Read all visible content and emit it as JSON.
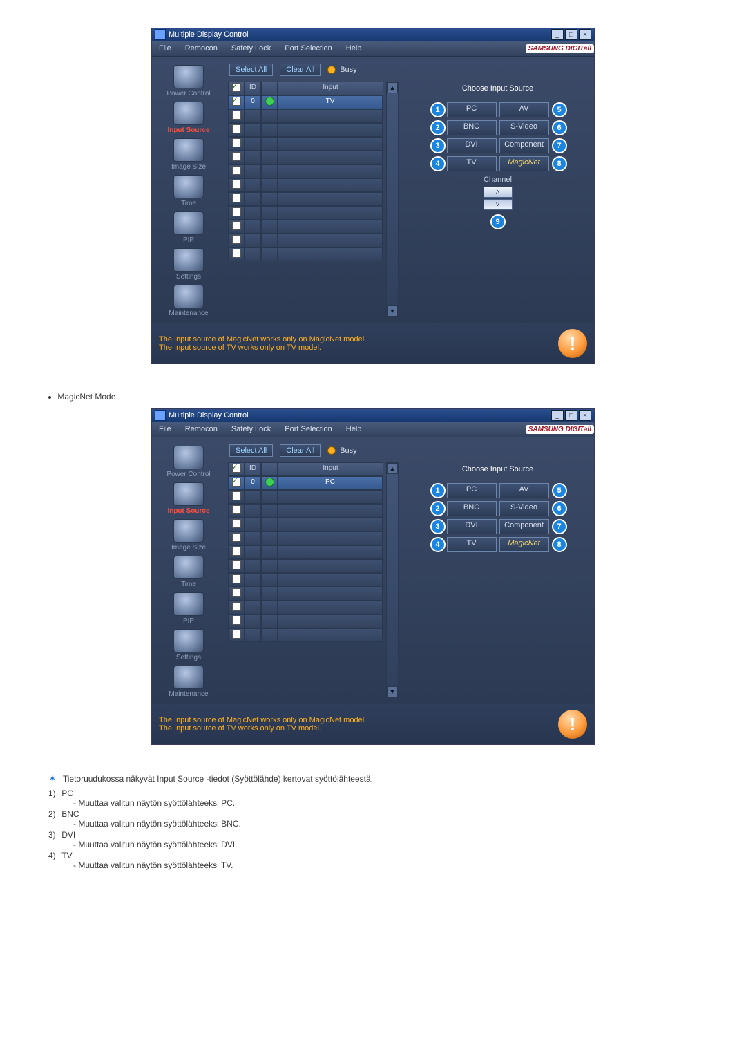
{
  "window": {
    "title": "Multiple Display Control",
    "menus": [
      "File",
      "Remocon",
      "Safety Lock",
      "Port Selection",
      "Help"
    ],
    "brand": "SAMSUNG DIGITall"
  },
  "sidebar": {
    "items": [
      {
        "label": "Power Control"
      },
      {
        "label": "Input Source"
      },
      {
        "label": "Image Size"
      },
      {
        "label": "Time"
      },
      {
        "label": "PIP"
      },
      {
        "label": "Settings"
      },
      {
        "label": "Maintenance"
      }
    ],
    "active_index": 1
  },
  "toolbar": {
    "select_all": "Select All",
    "clear_all": "Clear All",
    "busy": "Busy"
  },
  "grid": {
    "headers": {
      "chk": "✓",
      "id": "ID",
      "status": "",
      "input": "Input"
    },
    "first_row_tv": {
      "id": "0",
      "input": "TV"
    },
    "first_row_pc": {
      "id": "0",
      "input": "PC"
    },
    "empty_rows": 11
  },
  "panel": {
    "title": "Choose Input Source",
    "sources_left": [
      "PC",
      "BNC",
      "DVI",
      "TV"
    ],
    "sources_right": [
      "AV",
      "S-Video",
      "Component",
      "MagicNet"
    ],
    "nums_left": [
      "1",
      "2",
      "3",
      "4"
    ],
    "nums_right": [
      "5",
      "6",
      "7",
      "8"
    ],
    "channel_label": "Channel",
    "channel_badge": "9"
  },
  "footer": {
    "line1": "The Input source of MagicNet works only on MagicNet model.",
    "line2": "The Input source of TV works only on TV  model."
  },
  "doc": {
    "mode_line": "MagicNet Mode",
    "intro": "Tietoruudukossa näkyvät Input Source -tiedot (Syöttölähde) kertovat syöttölähteestä.",
    "items": [
      {
        "n": "1)",
        "t": "PC",
        "d": "- Muuttaa valitun näytön syöttölähteeksi PC."
      },
      {
        "n": "2)",
        "t": "BNC",
        "d": "- Muuttaa valitun näytön syöttölähteeksi BNC."
      },
      {
        "n": "3)",
        "t": "DVI",
        "d": "- Muuttaa valitun näytön syöttölähteeksi DVI."
      },
      {
        "n": "4)",
        "t": "TV",
        "d": "- Muuttaa valitun näytön syöttölähteeksi TV."
      }
    ]
  }
}
